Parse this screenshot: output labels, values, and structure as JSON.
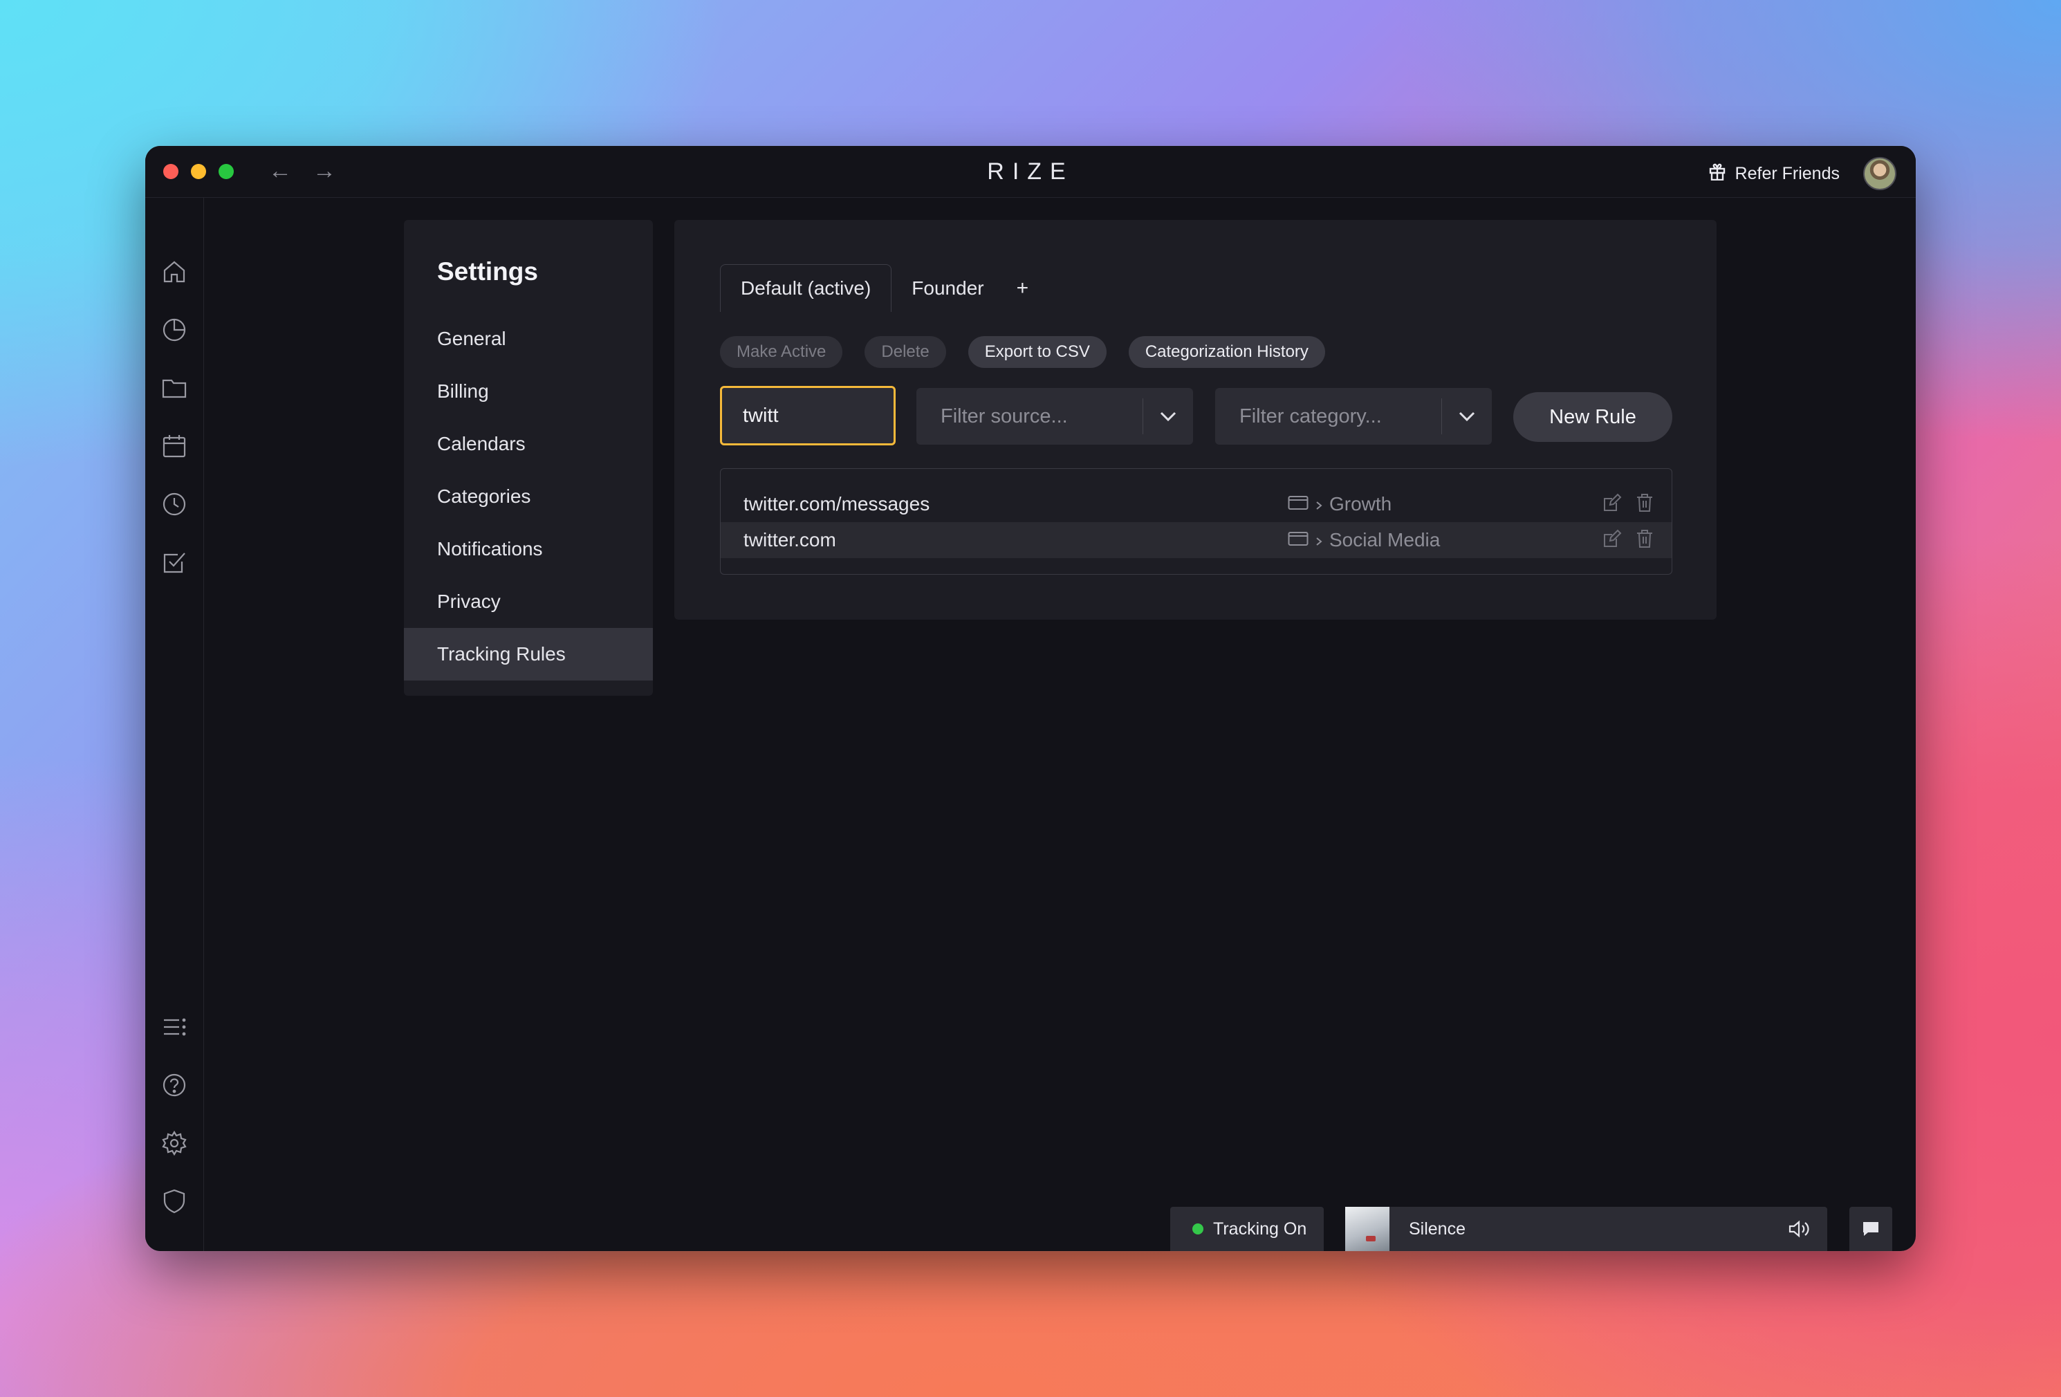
{
  "window": {
    "app_title": "RIZE",
    "nav": {
      "back_icon": "←",
      "forward_icon": "→"
    },
    "refer_label": "Refer Friends"
  },
  "rail": {
    "top_icons": [
      "home-icon",
      "pie-chart-icon",
      "folder-icon",
      "calendar-icon",
      "clock-icon",
      "checklist-icon"
    ],
    "bottom_icons": [
      "list-icon",
      "help-icon",
      "gear-icon",
      "shield-icon"
    ]
  },
  "settings": {
    "title": "Settings",
    "items": [
      {
        "label": "General"
      },
      {
        "label": "Billing"
      },
      {
        "label": "Calendars"
      },
      {
        "label": "Categories"
      },
      {
        "label": "Notifications"
      },
      {
        "label": "Privacy"
      },
      {
        "label": "Tracking Rules",
        "active": true
      }
    ]
  },
  "profiles": {
    "tabs": [
      {
        "label": "Default (active)",
        "active": true
      },
      {
        "label": "Founder"
      }
    ],
    "add_label": "+"
  },
  "actions": {
    "make_active": "Make Active",
    "delete": "Delete",
    "export_csv": "Export to CSV",
    "history": "Categorization History"
  },
  "filters": {
    "search_value": "twitt",
    "source_placeholder": "Filter source...",
    "category_placeholder": "Filter category...",
    "new_rule": "New Rule"
  },
  "rules": [
    {
      "name": "twitter.com/messages",
      "category": "Growth"
    },
    {
      "name": "twitter.com",
      "category": "Social Media"
    }
  ],
  "status": {
    "tracking": "Tracking On",
    "music_title": "Silence"
  },
  "colors": {
    "accent_focus": "#f5b93a",
    "tracking_dot": "#34c84a",
    "window_bg": "#121218",
    "panel_bg": "#1d1d24"
  }
}
